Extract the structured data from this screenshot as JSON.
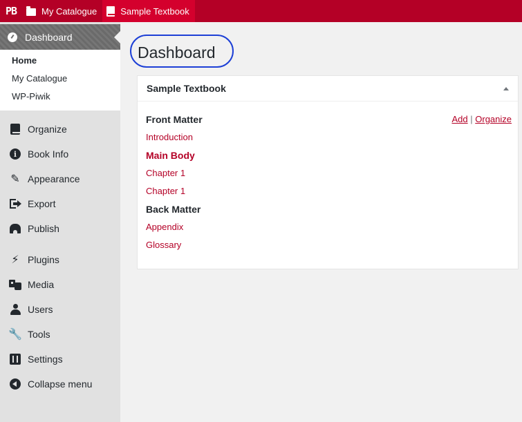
{
  "adminbar": {
    "logo": "PB",
    "catalogue_label": "My Catalogue",
    "book_label": "Sample Textbook"
  },
  "sidebar": {
    "dashboard_label": "Dashboard",
    "submenu": [
      "Home",
      "My Catalogue",
      "WP-Piwik"
    ],
    "group1": [
      {
        "label": "Organize",
        "icon": "book-icon"
      },
      {
        "label": "Book Info",
        "icon": "info-icon"
      },
      {
        "label": "Appearance",
        "icon": "paintbrush-icon"
      },
      {
        "label": "Export",
        "icon": "export-icon"
      },
      {
        "label": "Publish",
        "icon": "store-icon"
      }
    ],
    "group2": [
      {
        "label": "Plugins",
        "icon": "plugin-icon"
      },
      {
        "label": "Media",
        "icon": "media-icon"
      },
      {
        "label": "Users",
        "icon": "users-icon"
      },
      {
        "label": "Tools",
        "icon": "wrench-icon"
      },
      {
        "label": "Settings",
        "icon": "settings-icon"
      },
      {
        "label": "Collapse menu",
        "icon": "collapse-icon"
      }
    ]
  },
  "main": {
    "title": "Dashboard",
    "widget": {
      "title": "Sample Textbook",
      "actions": {
        "add": "Add",
        "separator": "|",
        "organize": "Organize"
      },
      "front_matter": "Front Matter",
      "front_items": [
        "Introduction"
      ],
      "main_body": "Main Body",
      "main_items": [
        "Chapter 1",
        "Chapter 1"
      ],
      "back_matter": "Back Matter",
      "back_items": [
        "Appendix",
        "Glossary"
      ]
    }
  },
  "colors": {
    "brand_red": "#b40026",
    "highlight_circle": "#1c3fd6"
  }
}
